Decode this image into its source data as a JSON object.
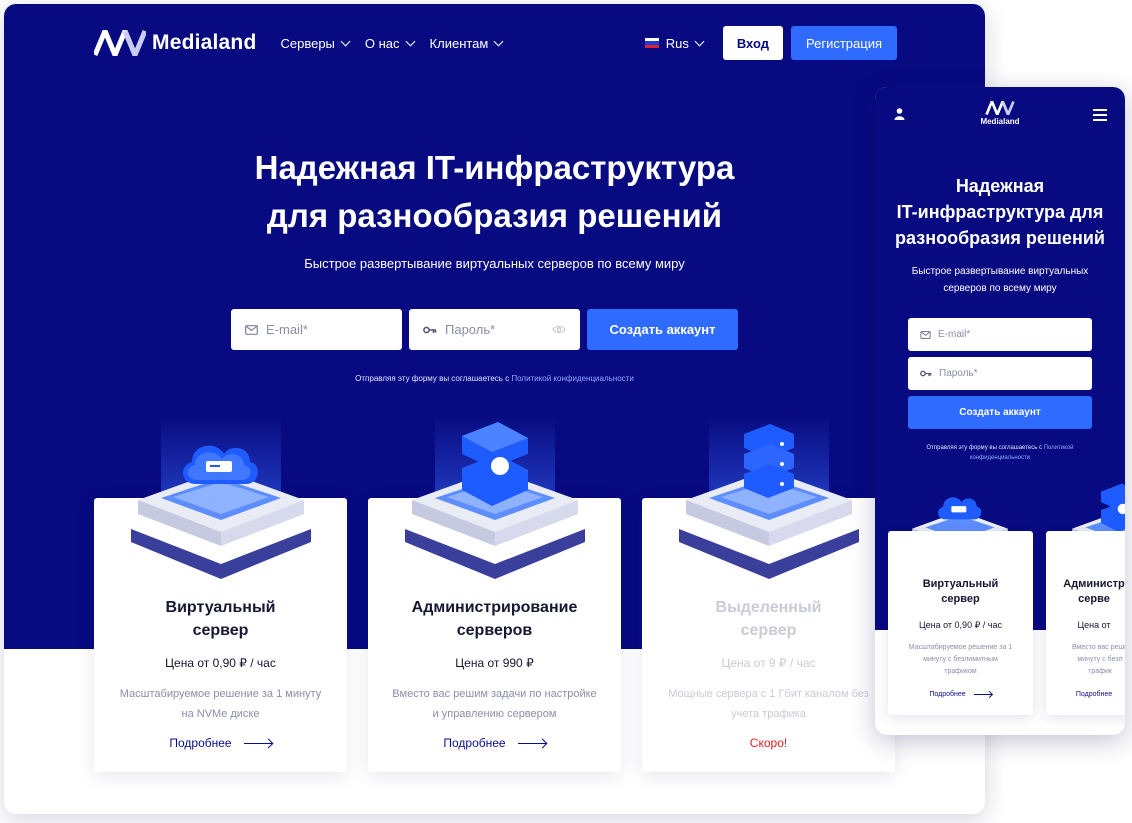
{
  "brand": {
    "name": "Medialand"
  },
  "nav": {
    "items": [
      {
        "label": "Серверы"
      },
      {
        "label": "О нас"
      },
      {
        "label": "Клиентам"
      }
    ],
    "language": "Rus",
    "login": "Вход",
    "register": "Регистрация"
  },
  "hero": {
    "title_line1": "Надежная IT-инфраструктура",
    "title_line2": "для разнообразия решений",
    "subtitle": "Быстрое развертывание виртуальных серверов по всему миру",
    "email_placeholder": "E-mail*",
    "password_placeholder": "Пароль*",
    "submit": "Создать аккаунт",
    "consent_prefix": "Отправляя эту форму вы соглашаетесь с ",
    "consent_link": "Политикой конфиденциальности"
  },
  "cards": [
    {
      "title_line1": "Виртуальный",
      "title_line2": "сервер",
      "price": "Цена от 0,90 ₽ / час",
      "desc_line1": "Масштабируемое решение за 1 минуту",
      "desc_line2": "на NVMe диске",
      "action": "Подробнее",
      "icon": "cloud-server-icon"
    },
    {
      "title_line1": "Администрирование",
      "title_line2": "серверов",
      "price": "Цена от 990 ₽",
      "desc_line1": "Вместо вас решим задачи по настройке",
      "desc_line2": "и управлению сервером",
      "action": "Подробнее",
      "icon": "admin-server-icon"
    },
    {
      "title_line1": "Выделенный",
      "title_line2": "сервер",
      "price": "Цена от 9 ₽ / час",
      "desc_line1": "Мощные сервера с 1 Гбит каналом без",
      "desc_line2": "учета трафика",
      "action": "Скоро!",
      "icon": "dedicated-server-icon"
    }
  ],
  "mobile": {
    "brand": "Medialand",
    "title_line1": "Надежная",
    "title_line2": "IT-инфраструктура для",
    "title_line3": "разнообразия решений",
    "subtitle_line1": "Быстрое развертывание виртуальных",
    "subtitle_line2": "серверов по всему миру",
    "email_placeholder": "E-mail*",
    "password_placeholder": "Пароль*",
    "submit": "Создать аккаунт",
    "consent_prefix": "Отправляя эту форму вы соглашаетесь с ",
    "consent_link_line1": "Политикой",
    "consent_link_line2": "конфиденциальности",
    "cards": [
      {
        "title_line1": "Виртуальный",
        "title_line2": "сервер",
        "price": "Цена от 0,90 ₽ / час",
        "desc_line1": "Масштабируемое решение за 1",
        "desc_line2": "минуту с безлимитным",
        "desc_line3": "трафиком",
        "action": "Подробнее"
      },
      {
        "title_line1": "Администр",
        "title_line2": "серве",
        "price": "Цена от",
        "desc_line1": "Вместо вас реши",
        "desc_line2": "минуту с безл",
        "desc_line3": "трафик",
        "action": "Подробнее"
      }
    ]
  },
  "colors": {
    "hero_bg": "#070a80",
    "accent": "#2f6bff",
    "link": "#0a0f8a",
    "soon": "#e01e1e"
  }
}
